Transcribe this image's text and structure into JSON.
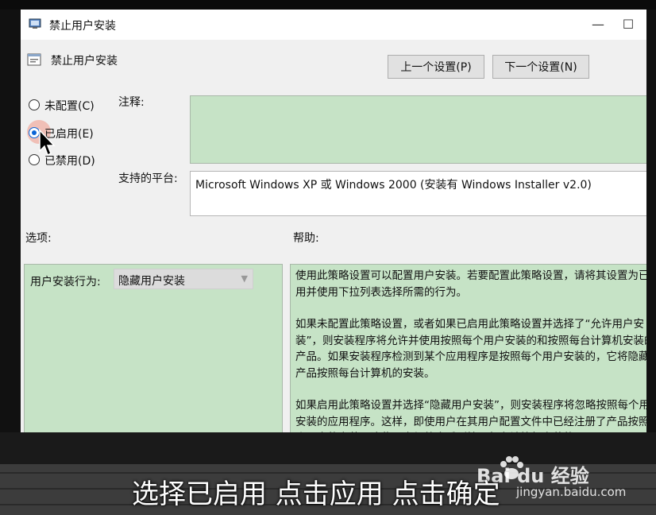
{
  "window": {
    "title": "禁止用户安装",
    "minimize_icon": "minimize-icon",
    "maximize_icon": "maximize-icon"
  },
  "policy": {
    "name": "禁止用户安装",
    "prev_button": "上一个设置(P)",
    "next_button": "下一个设置(N)"
  },
  "state_options": [
    {
      "label": "未配置(C)",
      "checked": false
    },
    {
      "label": "已启用(E)",
      "checked": true
    },
    {
      "label": "已禁用(D)",
      "checked": false
    }
  ],
  "labels": {
    "comment": "注释:",
    "platform": "支持的平台:",
    "options": "选项:",
    "help": "帮助:"
  },
  "comment_value": "",
  "platform_value": "Microsoft Windows XP 或 Windows 2000 (安装有 Windows Installer v2.0)",
  "options": {
    "install_behavior_label": "用户安装行为:",
    "install_behavior_value": "隐藏用户安装"
  },
  "help": {
    "p1": "使用此策略设置可以配置用户安装。若要配置此策略设置，请将其设置为已启用并使用下拉列表选择所需的行为。",
    "p2": "如果未配置此策略设置，或者如果已启用此策略设置并选择了“允许用户安装”，则安装程序将允许并使用按照每个用户安装的和按照每台计算机安装的产品。如果安装程序检测到某个应用程序是按照每个用户安装的，它将隐藏该产品按照每台计算机的安装。",
    "p3": "如果启用此策略设置并选择“隐藏用户安装”，则安装程序将忽略按照每个用户安装的应用程序。这样，即使用户在其用户配置文件中已经注册了产品按照每个用户的安装，这些用户仍将会看到按照每台计算机安装的"
  },
  "caption": "选择已启用 点击应用 点击确定",
  "watermark": {
    "text": "Bai du 经验",
    "url": "jingyan.baidu.com"
  },
  "colors": {
    "panel_green": "#c6e3c6",
    "radio_accent": "#0a64d6"
  }
}
